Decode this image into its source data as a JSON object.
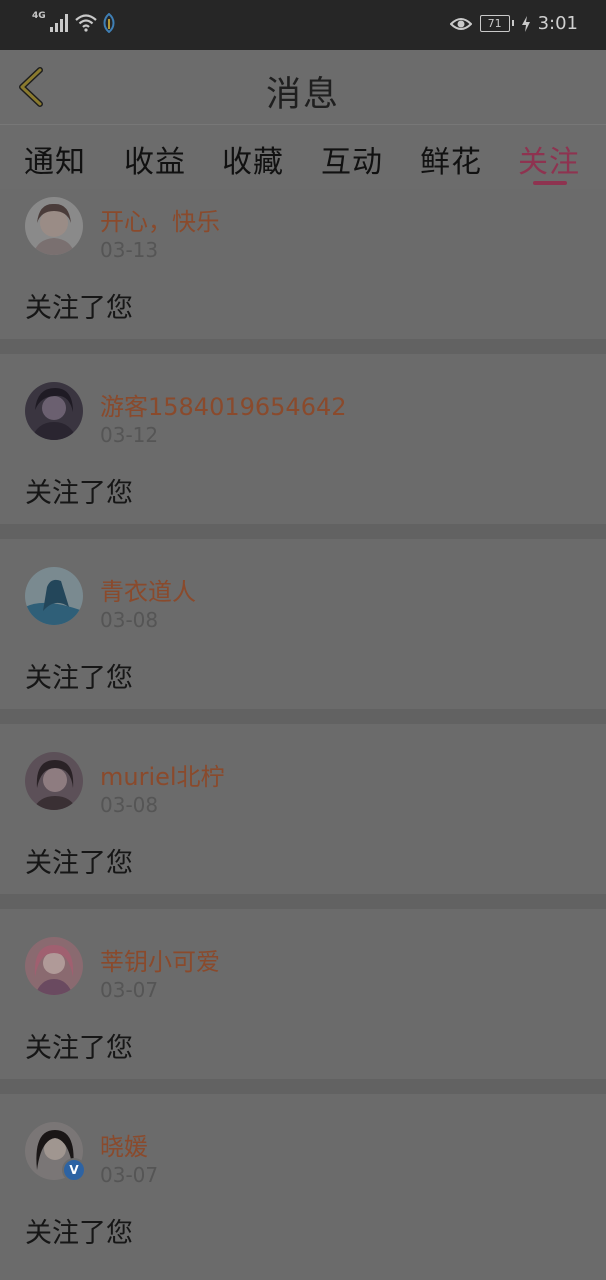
{
  "status_bar": {
    "network": "4G",
    "battery": "71",
    "time": "3:01",
    "icons": [
      "signal-icon",
      "wifi-icon",
      "leaf-icon",
      "eye-icon",
      "battery-icon",
      "charging-icon"
    ]
  },
  "header": {
    "title": "消息",
    "back_icon": "back-chevron-icon"
  },
  "tabs": [
    {
      "label": "通知",
      "active": false
    },
    {
      "label": "收益",
      "active": false
    },
    {
      "label": "收藏",
      "active": false
    },
    {
      "label": "互动",
      "active": false
    },
    {
      "label": "鲜花",
      "active": false
    },
    {
      "label": "关注",
      "active": true
    }
  ],
  "colors": {
    "accent": "#8e3350",
    "username": "#8a4a2c",
    "date": "#555555",
    "overlay_bg": "#6b6b6b"
  },
  "follows": [
    {
      "name": "开心，快乐",
      "date": "03-13",
      "message": "关注了您",
      "verified": false
    },
    {
      "name": "游客1584019654642",
      "date": "03-12",
      "message": "关注了您",
      "verified": false
    },
    {
      "name": "青衣道人",
      "date": "03-08",
      "message": "关注了您",
      "verified": false
    },
    {
      "name": "muriel北柠",
      "date": "03-08",
      "message": "关注了您",
      "verified": false
    },
    {
      "name": "莘钥小可爱",
      "date": "03-07",
      "message": "关注了您",
      "verified": false
    },
    {
      "name": "晓媛",
      "date": "03-07",
      "message": "关注了您",
      "verified": true
    }
  ]
}
